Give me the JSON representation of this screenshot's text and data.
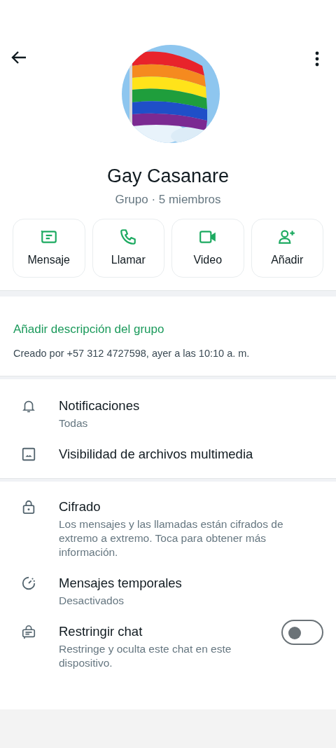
{
  "profile": {
    "name": "Gay Casanare",
    "subtitle": "Grupo · 5 miembros"
  },
  "actions": [
    {
      "label": "Mensaje"
    },
    {
      "label": "Llamar"
    },
    {
      "label": "Video"
    },
    {
      "label": "Añadir"
    }
  ],
  "description": {
    "link": "Añadir descripción del grupo",
    "created": "Creado por +57 312 4727598, ayer a las 10:10 a. m."
  },
  "sections": [
    {
      "items": [
        {
          "kind": "plain",
          "title": "Notificaciones",
          "subtitle": "Todas"
        },
        {
          "kind": "plain",
          "title": "Visibilidad de archivos multimedia"
        }
      ]
    },
    {
      "items": [
        {
          "kind": "plain",
          "title": "Cifrado",
          "subtitle": "Los mensajes y las llamadas están cifrados de extremo a extremo. Toca para obtener más información."
        },
        {
          "kind": "plain",
          "title": "Mensajes temporales",
          "subtitle": "Desactivados"
        },
        {
          "kind": "toggle",
          "title": "Restringir chat",
          "subtitle": "Restringe y oculta este chat en este dispositivo.",
          "on": false
        }
      ]
    }
  ]
}
